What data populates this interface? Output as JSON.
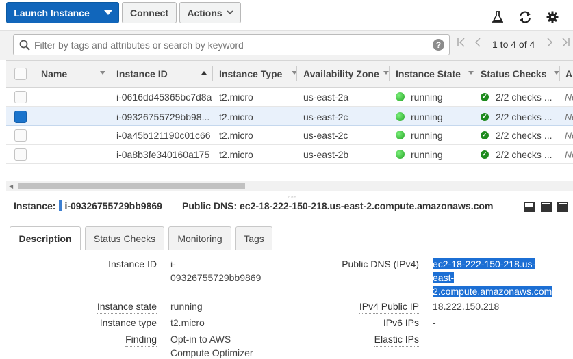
{
  "toolbar": {
    "launch_label": "Launch Instance",
    "connect_label": "Connect",
    "actions_label": "Actions"
  },
  "filter": {
    "placeholder": "Filter by tags and attributes or search by keyword",
    "help": "?",
    "pagination": "1 to 4 of 4"
  },
  "table": {
    "columns": [
      "Name",
      "Instance ID",
      "Instance Type",
      "Availability Zone",
      "Instance State",
      "Status Checks",
      "Al"
    ],
    "sorted_column": "Instance ID",
    "rows": [
      {
        "name": "",
        "id": "i-0616dd45365bc7d8a",
        "type": "t2.micro",
        "zone": "us-east-2a",
        "state": "running",
        "checks": "2/2 checks ...",
        "extra": "No",
        "selected": false
      },
      {
        "name": "",
        "id": "i-09326755729bb98...",
        "type": "t2.micro",
        "zone": "us-east-2c",
        "state": "running",
        "checks": "2/2 checks ...",
        "extra": "No",
        "selected": true
      },
      {
        "name": "",
        "id": "i-0a45b121190c01c66",
        "type": "t2.micro",
        "zone": "us-east-2c",
        "state": "running",
        "checks": "2/2 checks ...",
        "extra": "No",
        "selected": false
      },
      {
        "name": "",
        "id": "i-0a8b3fe340160a175",
        "type": "t2.micro",
        "zone": "us-east-2b",
        "state": "running",
        "checks": "2/2 checks ...",
        "extra": "No",
        "selected": false
      }
    ]
  },
  "detail": {
    "instance_label": "Instance:",
    "instance_id": "i-09326755729bb9869",
    "dns_header": "Public DNS: ec2-18-222-150-218.us-east-2.compute.amazonaws.com",
    "tabs": [
      "Description",
      "Status Checks",
      "Monitoring",
      "Tags"
    ],
    "active_tab": "Description",
    "left": [
      {
        "label": "Instance ID",
        "value_lines": [
          "i-",
          "09326755729bb9869"
        ]
      },
      {
        "label": "Instance state",
        "value_lines": [
          "running"
        ]
      },
      {
        "label": "Instance type",
        "value_lines": [
          "t2.micro"
        ]
      },
      {
        "label": "Finding",
        "value_lines": [
          "Opt-in to AWS",
          "Compute Optimizer"
        ]
      }
    ],
    "right": [
      {
        "label": "Public DNS (IPv4)",
        "value_lines": [
          "ec2-18-222-150-218.us-",
          "east-",
          "2.compute.amazonaws.com"
        ],
        "highlighted": true
      },
      {
        "label": "IPv4 Public IP",
        "value_lines": [
          "18.222.150.218"
        ]
      },
      {
        "label": "IPv6 IPs",
        "value_lines": [
          "-"
        ]
      },
      {
        "label": "Elastic IPs",
        "value_lines": [
          ""
        ]
      }
    ]
  }
}
